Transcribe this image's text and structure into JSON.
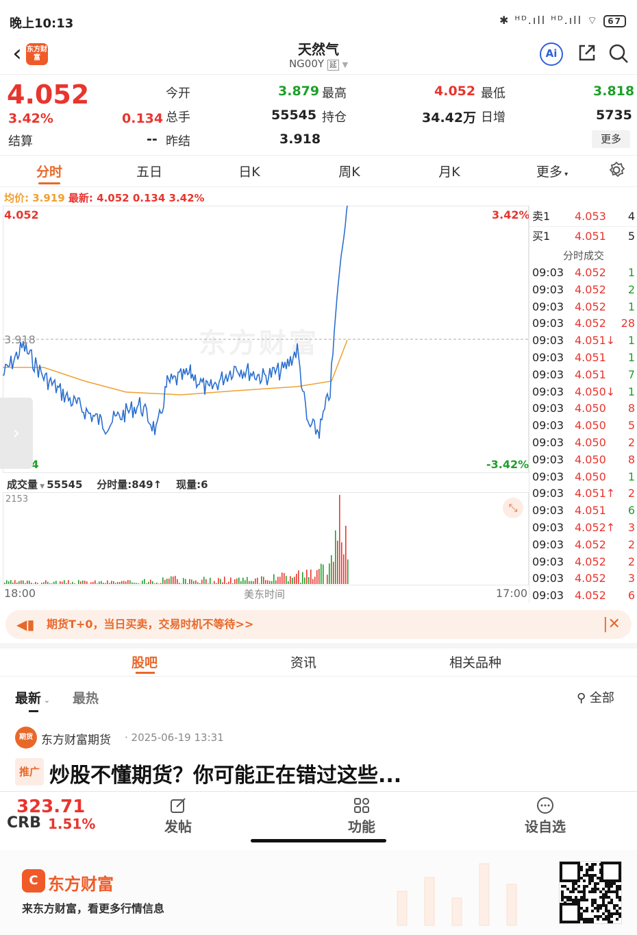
{
  "status": {
    "time": "晚上10:13",
    "signal": "ᴴᴰ.ıll ᴴᴰ.ıll",
    "battery": "67"
  },
  "header": {
    "title": "天然气",
    "code": "NG00Y",
    "tag": "延",
    "logo_text": "东方财富"
  },
  "quote": {
    "price": "4.052",
    "pct": "3.42%",
    "change": "0.134",
    "open_label": "今开",
    "open": "3.879",
    "high_label": "最高",
    "high": "4.052",
    "low_label": "最低",
    "low": "3.818",
    "vol_label": "总手",
    "vol": "55545",
    "oi_label": "持仓",
    "oi": "34.42万",
    "daily_label": "日增",
    "daily": "5735",
    "settle_label": "结算",
    "settle": "--",
    "prev_label": "昨结",
    "prev": "3.918",
    "more": "更多"
  },
  "tabs": [
    "分时",
    "五日",
    "日K",
    "周K",
    "月K",
    "更多"
  ],
  "info": {
    "avg_label": "均价:",
    "avg": "3.919",
    "last_label": "最新:",
    "last": "4.052",
    "chg": "0.134",
    "pct": "3.42%"
  },
  "chart": {
    "top_price": "4.052",
    "top_pct": "3.42%",
    "bottom_price": "3.784",
    "bottom_pct": "-3.42%",
    "ref_price": "3.918",
    "watermark": "东方财富",
    "vol_label": "成交量",
    "vol_value": "55545",
    "tick_label": "分时量:849↑",
    "now_label": "现量:6",
    "vol_max": "2153",
    "x_start": "18:00",
    "x_mid": "美东时间",
    "x_end": "17:00"
  },
  "orderbook": {
    "ask_label": "卖1",
    "ask_price": "4.053",
    "ask_vol": "4",
    "bid_label": "买1",
    "bid_price": "4.051",
    "bid_vol": "5",
    "trades_title": "分时成交",
    "trades": [
      {
        "t": "09:03",
        "p": "4.052",
        "v": "1",
        "pc": "red",
        "vc": "green"
      },
      {
        "t": "09:03",
        "p": "4.052",
        "v": "2",
        "pc": "red",
        "vc": "green"
      },
      {
        "t": "09:03",
        "p": "4.052",
        "v": "1",
        "pc": "red",
        "vc": "green"
      },
      {
        "t": "09:03",
        "p": "4.052",
        "v": "28",
        "pc": "red",
        "vc": "red"
      },
      {
        "t": "09:03",
        "p": "4.051↓",
        "v": "1",
        "pc": "red",
        "vc": "green"
      },
      {
        "t": "09:03",
        "p": "4.051",
        "v": "1",
        "pc": "red",
        "vc": "green"
      },
      {
        "t": "09:03",
        "p": "4.051",
        "v": "7",
        "pc": "red",
        "vc": "green"
      },
      {
        "t": "09:03",
        "p": "4.050↓",
        "v": "1",
        "pc": "red",
        "vc": "green"
      },
      {
        "t": "09:03",
        "p": "4.050",
        "v": "8",
        "pc": "red",
        "vc": "red"
      },
      {
        "t": "09:03",
        "p": "4.050",
        "v": "5",
        "pc": "red",
        "vc": "red"
      },
      {
        "t": "09:03",
        "p": "4.050",
        "v": "2",
        "pc": "red",
        "vc": "red"
      },
      {
        "t": "09:03",
        "p": "4.050",
        "v": "8",
        "pc": "red",
        "vc": "red"
      },
      {
        "t": "09:03",
        "p": "4.050",
        "v": "1",
        "pc": "red",
        "vc": "green"
      },
      {
        "t": "09:03",
        "p": "4.051↑",
        "v": "2",
        "pc": "red",
        "vc": "red"
      },
      {
        "t": "09:03",
        "p": "4.051",
        "v": "6",
        "pc": "red",
        "vc": "green"
      },
      {
        "t": "09:03",
        "p": "4.052↑",
        "v": "3",
        "pc": "red",
        "vc": "red"
      },
      {
        "t": "09:03",
        "p": "4.052",
        "v": "2",
        "pc": "red",
        "vc": "red"
      },
      {
        "t": "09:03",
        "p": "4.052",
        "v": "2",
        "pc": "red",
        "vc": "red"
      },
      {
        "t": "09:03",
        "p": "4.052",
        "v": "3",
        "pc": "red",
        "vc": "red"
      },
      {
        "t": "09:03",
        "p": "4.052",
        "v": "6",
        "pc": "red",
        "vc": "red"
      }
    ]
  },
  "banner": {
    "text": "期货T+0，当日买卖，交易时机不等待>>"
  },
  "section_tabs": [
    "股吧",
    "资讯",
    "相关品种"
  ],
  "feed": {
    "sort_latest": "最新",
    "sort_hot": "最热",
    "filter": "全部",
    "author": "东方财富期货",
    "time": "· 2025-06-19 13:31",
    "avatar": "期货",
    "tag": "推广",
    "title": "炒股不懂期货？你可能正在错过这些..."
  },
  "bottom": {
    "crb_value": "323.71",
    "crb_name": "CRB",
    "crb_pct": "1.51%",
    "post": "发帖",
    "func": "功能",
    "watch": "设自选"
  },
  "footer": {
    "brand": "东方财富",
    "slogan": "来东方财富，看更多行情信息"
  },
  "colors": {
    "up": "#e8352e",
    "down": "#1e9f2a",
    "accent": "#e8682a",
    "price_line": "#2a6fcf",
    "avg_line": "#f0a030"
  }
}
